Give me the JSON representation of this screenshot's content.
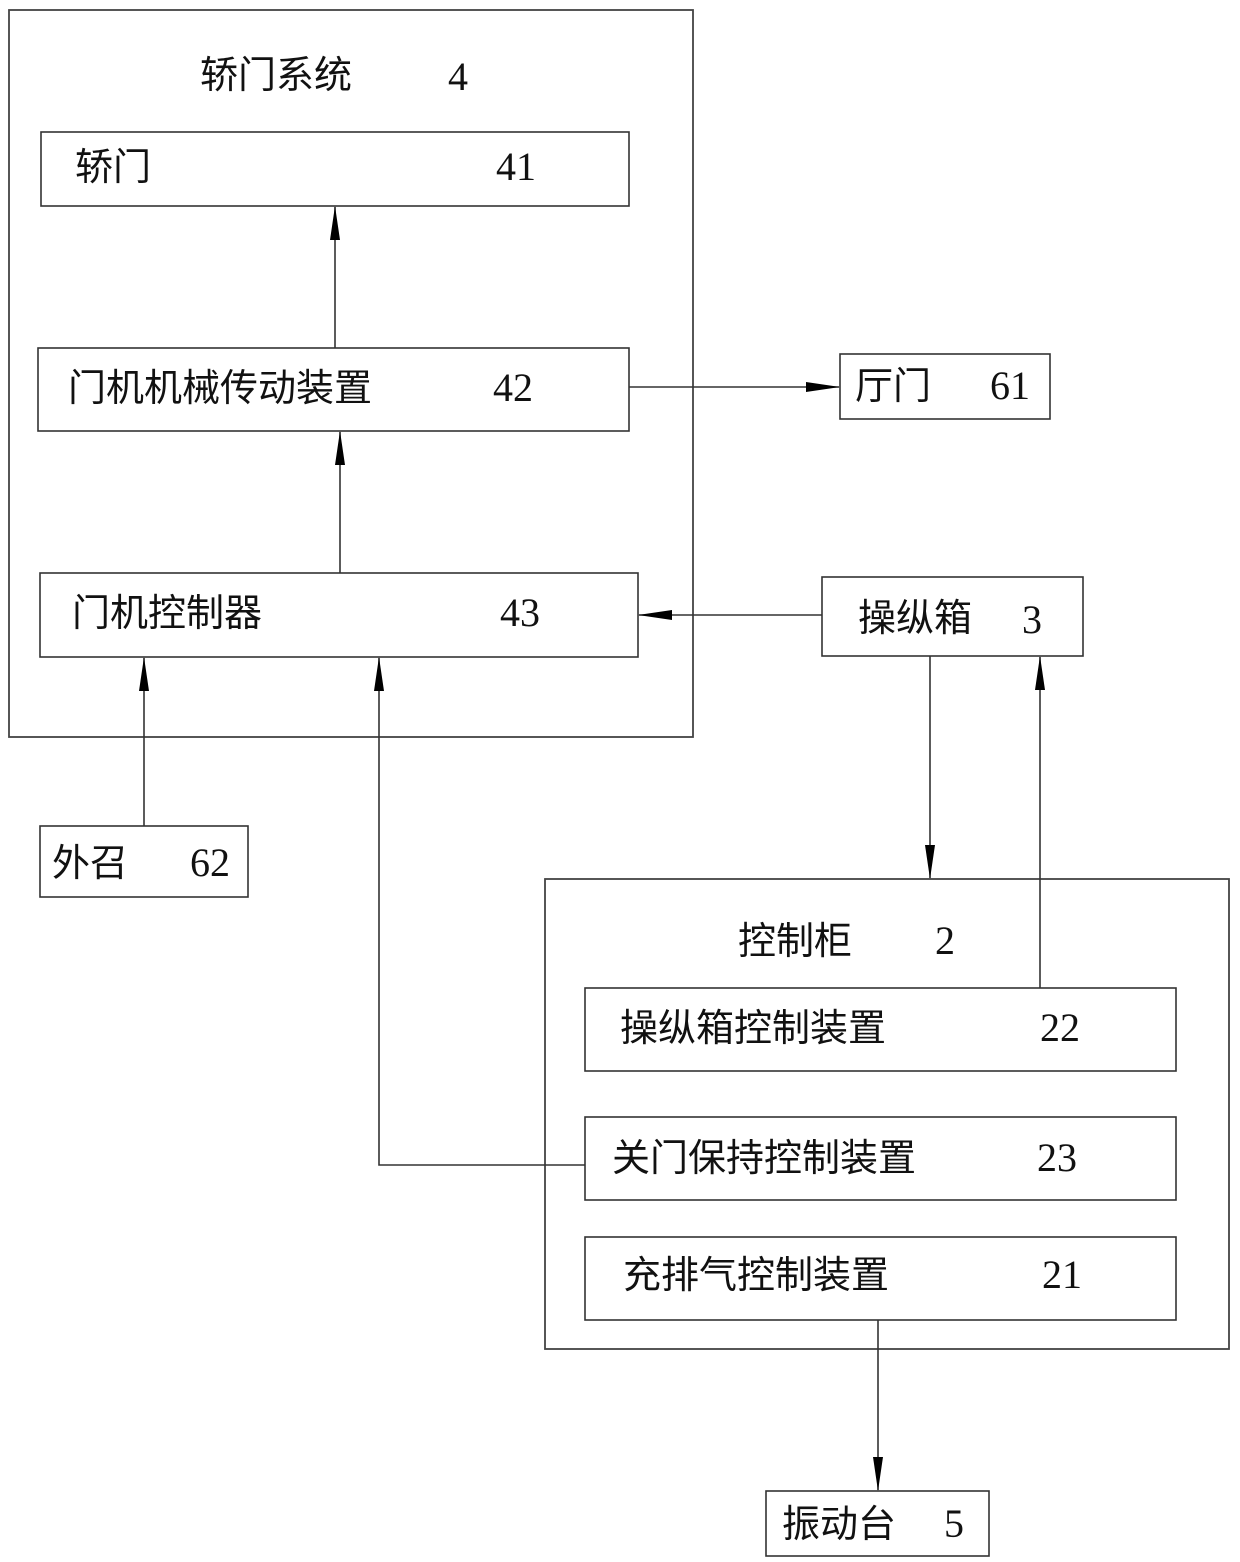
{
  "diagram": {
    "nodes": {
      "car_door_system": {
        "label": "轿门系统",
        "number": "4"
      },
      "car_door": {
        "label": "轿门",
        "number": "41"
      },
      "door_mech_drive": {
        "label": "门机机械传动装置",
        "number": "42"
      },
      "door_controller": {
        "label": "门机控制器",
        "number": "43"
      },
      "landing_door": {
        "label": "厅门",
        "number": "61"
      },
      "operating_panel": {
        "label": "操纵箱",
        "number": "3"
      },
      "outer_call": {
        "label": "外召",
        "number": "62"
      },
      "control_cabinet": {
        "label": "控制柜",
        "number": "2"
      },
      "panel_control_device": {
        "label": "操纵箱控制装置",
        "number": "22"
      },
      "door_close_hold_device": {
        "label": "关门保持控制装置",
        "number": "23"
      },
      "inflate_exhaust_device": {
        "label": "充排气控制装置",
        "number": "21"
      },
      "vibration_table": {
        "label": "振动台",
        "number": "5"
      }
    },
    "edges": [
      {
        "from": "door_mech_drive",
        "to": "car_door"
      },
      {
        "from": "door_controller",
        "to": "door_mech_drive"
      },
      {
        "from": "door_mech_drive",
        "to": "landing_door"
      },
      {
        "from": "operating_panel",
        "to": "door_controller"
      },
      {
        "from": "outer_call",
        "to": "door_controller"
      },
      {
        "from": "door_close_hold_device",
        "to": "door_controller"
      },
      {
        "from": "operating_panel",
        "to": "control_cabinet"
      },
      {
        "from": "panel_control_device",
        "to": "operating_panel"
      },
      {
        "from": "inflate_exhaust_device",
        "to": "vibration_table"
      }
    ]
  }
}
